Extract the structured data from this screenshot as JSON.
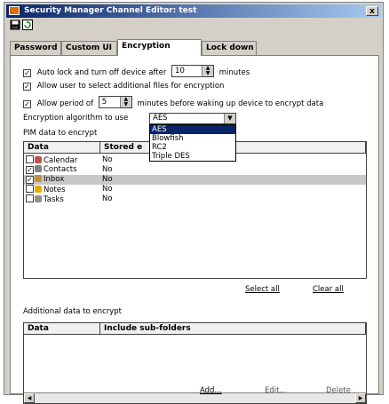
{
  "window": {
    "title": "Security Manager Channel Editor: test",
    "close_label": "x"
  },
  "tabs": [
    {
      "label": "Password"
    },
    {
      "label": "Custom UI"
    },
    {
      "label": "Encryption"
    },
    {
      "label": "Lock down"
    }
  ],
  "active_tab": "Encryption",
  "options": {
    "auto_lock": {
      "label_pre": "Auto lock and turn off device after",
      "value": "10",
      "label_post": "minutes",
      "checked": true
    },
    "allow_select": {
      "label": "Allow user to select additional files for encryption",
      "checked": true
    },
    "allow_period": {
      "label_pre": "Allow period of",
      "value": "5",
      "label_post": "minutes before waking up device to encrypt data",
      "checked": true
    }
  },
  "algorithm": {
    "label": "Encryption algorithm to use",
    "selected": "AES",
    "options": [
      "AES",
      "Blowfish",
      "RC2",
      "Triple DES"
    ]
  },
  "pim": {
    "label": "PIM data to encrypt",
    "columns": [
      "Data",
      "Stored e"
    ],
    "rows": [
      {
        "name": "Calendar",
        "stored": "No",
        "checked": false,
        "highlight": false,
        "icon_color": "#c05050"
      },
      {
        "name": "Contacts",
        "stored": "No",
        "checked": true,
        "highlight": false,
        "icon_color": "#808080"
      },
      {
        "name": "Inbox",
        "stored": "No",
        "checked": true,
        "highlight": true,
        "icon_color": "#c09040"
      },
      {
        "name": "Notes",
        "stored": "No",
        "checked": false,
        "highlight": false,
        "icon_color": "#e0b000"
      },
      {
        "name": "Tasks",
        "stored": "No",
        "checked": false,
        "highlight": false,
        "icon_color": "#909090"
      }
    ]
  },
  "links": {
    "select_all": "Select all",
    "clear_all": "Clear all"
  },
  "additional": {
    "label": "Additional data to encrypt",
    "columns": [
      "Data",
      "Include sub-folders"
    ]
  },
  "buttons": {
    "add": "Add...",
    "edit": "Edit...",
    "delete": "Delete"
  }
}
